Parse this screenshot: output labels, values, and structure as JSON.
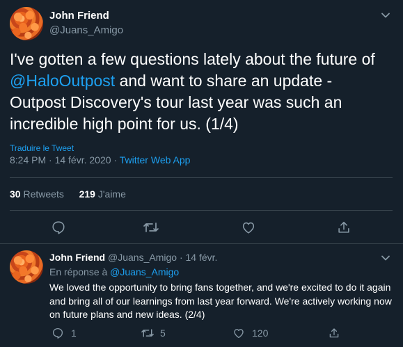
{
  "main_tweet": {
    "author_name": "John Friend",
    "author_handle": "@Juans_Amigo",
    "text_before": "I've gotten a few questions lately about the future of ",
    "mention": "@HaloOutpost",
    "text_after": " and want to share an update - Outpost Discovery's tour last year was such an incredible high point for us.  (1/4)",
    "translate": "Traduire le Tweet",
    "timestamp": "8:24 PM · 14 févr. 2020",
    "separator": " · ",
    "source": "Twitter Web App",
    "retweets_count": "30",
    "retweets_label": "Retweets",
    "likes_count": "219",
    "likes_label": "J'aime"
  },
  "reply_tweet": {
    "author_name": "John Friend",
    "author_handle": "@Juans_Amigo",
    "date": "· 14 févr.",
    "reply_prefix": "En réponse à ",
    "reply_to": "@Juans_Amigo",
    "text": "We loved the opportunity to bring fans together, and we're excited to do it again and bring all of our learnings from last year forward.  We're actively working now on future plans and new ideas. (2/4)",
    "reply_count": "1",
    "retweet_count": "5",
    "like_count": "120"
  },
  "colors": {
    "background": "#15202b",
    "accent": "#1da1f2",
    "muted": "#8899a6",
    "divider": "#38444d"
  },
  "icons": [
    "chevron-down-icon",
    "reply-icon",
    "retweet-icon",
    "like-icon",
    "share-icon"
  ]
}
